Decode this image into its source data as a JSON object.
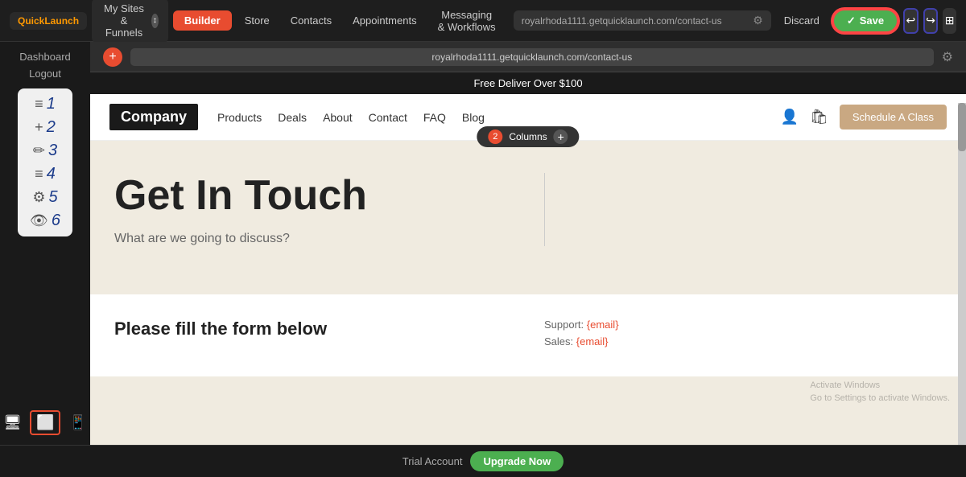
{
  "logo": {
    "text": "uickLaunch"
  },
  "topnav": {
    "sites_label": "My Sites & Funnels",
    "sites_badge": "↕",
    "builder_label": "Builder",
    "store_label": "Store",
    "contacts_label": "Contacts",
    "appointments_label": "Appointments",
    "messaging_label": "Messaging & Workflows",
    "discard_label": "Discard",
    "save_label": "Save",
    "url": "royalrhoda1111.getquicklаunch.com/contact-us"
  },
  "left_sidebar": {
    "dashboard_label": "Dashboard",
    "logout_label": "Logout",
    "items": [
      {
        "icon": "≡",
        "num": "1"
      },
      {
        "icon": "+",
        "num": "2"
      },
      {
        "icon": "✏",
        "num": "3"
      },
      {
        "icon": "≡",
        "num": "4"
      },
      {
        "icon": "⚙",
        "num": "5"
      },
      {
        "icon": "👁",
        "num": "6"
      }
    ]
  },
  "site": {
    "promo_bar": "Free Deliver Over $100",
    "logo": "Company",
    "nav": [
      "Products",
      "Deals",
      "About",
      "Contact",
      "FAQ",
      "Blog"
    ],
    "schedule_btn": "Schedule A Class",
    "hero_title": "Get In Touch",
    "hero_sub": "What are we going to discuss?",
    "columns_label": "Columns",
    "columns_count": "2",
    "form_title": "Please fill the form below",
    "support_label": "Support:",
    "support_email": "{email}",
    "sales_label": "Sales:",
    "sales_email": "{email}"
  },
  "bottom_bar": {
    "trial_label": "Trial Account",
    "upgrade_label": "Upgrade Now"
  },
  "activate_windows": {
    "line1": "Activate Windows",
    "line2": "Go to Settings to activate Windows."
  }
}
